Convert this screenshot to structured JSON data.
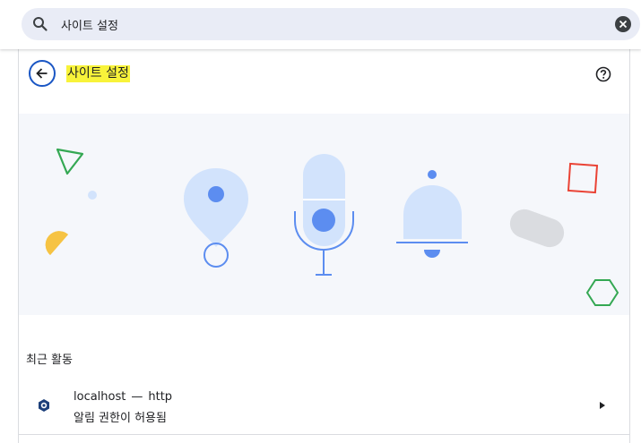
{
  "search": {
    "value": "사이트 설정",
    "placeholder": ""
  },
  "header": {
    "title": "사이트 설정"
  },
  "recent_activity": {
    "title": "최근 활동",
    "items": [
      {
        "site": "localhost",
        "separator": "—",
        "protocol": "http",
        "detail": "알림 권한이 허용됨"
      }
    ]
  },
  "colors": {
    "accent": "#1a56c4",
    "highlight": "#f8f33a",
    "illustration_blue": "#5c8df0"
  },
  "icons": [
    "search-icon",
    "clear-icon",
    "back-arrow-icon",
    "help-icon",
    "site-favicon-icon",
    "chevron-right-icon"
  ]
}
